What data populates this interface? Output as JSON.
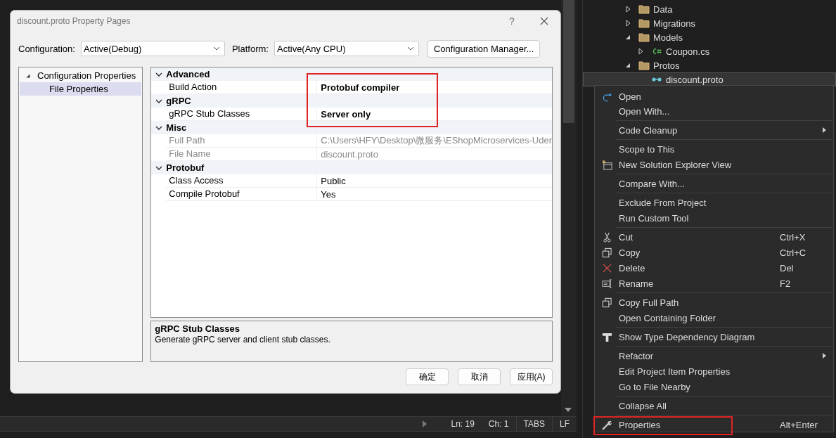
{
  "dialog": {
    "title": "discount.proto Property Pages",
    "help": "?",
    "configuration": {
      "label": "Configuration:",
      "value": "Active(Debug)"
    },
    "platform": {
      "label": "Platform:",
      "value": "Active(Any CPU)"
    },
    "manager_button": "Configuration Manager...",
    "tree": [
      {
        "label": "Configuration Properties",
        "expanded": true,
        "selected": false,
        "children": [
          {
            "label": "File Properties",
            "selected": true
          }
        ]
      }
    ],
    "grid": {
      "value_frame": true,
      "categories": [
        {
          "name": "Advanced",
          "expanded": true,
          "rows": [
            {
              "name": "Build Action",
              "value": "Protobuf compiler",
              "bold": true,
              "disabled": false
            }
          ]
        },
        {
          "name": "gRPC",
          "expanded": true,
          "rows": [
            {
              "name": "gRPC Stub Classes",
              "value": "Server only",
              "bold": true,
              "disabled": false
            }
          ]
        },
        {
          "name": "Misc",
          "expanded": true,
          "rows": [
            {
              "name": "Full Path",
              "value": "C:\\Users\\HFY\\Desktop\\微服务\\EShopMicroservices-Uder",
              "bold": false,
              "disabled": true
            },
            {
              "name": "File Name",
              "value": "discount.proto",
              "bold": false,
              "disabled": true
            }
          ]
        },
        {
          "name": "Protobuf",
          "expanded": true,
          "rows": [
            {
              "name": "Class Access",
              "value": "Public",
              "bold": false,
              "disabled": false
            },
            {
              "name": "Compile Protobuf",
              "value": "Yes",
              "bold": false,
              "disabled": false
            }
          ]
        }
      ]
    },
    "description": {
      "title": "gRPC Stub Classes",
      "text": "Generate gRPC server and client stub classes."
    },
    "buttons": [
      "确定",
      "取消",
      "应用(A)"
    ]
  },
  "status_bar": {
    "line": "Ln: 19",
    "column": "Ch: 1",
    "indent": "TABS",
    "line_ending": "LF"
  },
  "explorer": [
    {
      "label": "Data",
      "kind": "folder",
      "expanded": false,
      "selected": false
    },
    {
      "label": "Migrations",
      "kind": "folder",
      "expanded": false,
      "selected": false
    },
    {
      "label": "Models",
      "kind": "folder",
      "expanded": true,
      "selected": false,
      "children": [
        {
          "label": "Coupon.cs",
          "kind": "csharp",
          "expanded": false,
          "selected": false
        }
      ]
    },
    {
      "label": "Protos",
      "kind": "folder",
      "expanded": true,
      "selected": false,
      "children": [
        {
          "label": "discount.proto",
          "kind": "proto",
          "selected": true
        }
      ]
    }
  ],
  "context_menu": [
    [
      {
        "label": "Open",
        "kind": "open"
      },
      {
        "label": "Open With..."
      }
    ],
    [
      {
        "label": "Code Cleanup",
        "submenu": true
      }
    ],
    [
      {
        "label": "Scope to This"
      },
      {
        "label": "New Solution Explorer View",
        "kind": "window"
      }
    ],
    [
      {
        "label": "Compare With..."
      }
    ],
    [
      {
        "label": "Exclude From Project"
      },
      {
        "label": "Run Custom Tool"
      }
    ],
    [
      {
        "label": "Cut",
        "kind": "cut",
        "shortcut": "Ctrl+X"
      },
      {
        "label": "Copy",
        "kind": "copy",
        "shortcut": "Ctrl+C"
      },
      {
        "label": "Delete",
        "kind": "delete",
        "shortcut": "Del"
      },
      {
        "label": "Rename",
        "kind": "rename",
        "shortcut": "F2"
      }
    ],
    [
      {
        "label": "Copy Full Path",
        "kind": "copy"
      },
      {
        "label": "Open Containing Folder"
      }
    ],
    [
      {
        "label": "Show Type Dependency Diagram",
        "kind": "type"
      }
    ],
    [
      {
        "label": "Refactor",
        "submenu": true
      },
      {
        "label": "Edit Project Item Properties"
      },
      {
        "label": "Go to File Nearby"
      }
    ],
    [
      {
        "label": "Collapse All"
      }
    ],
    [
      {
        "label": "Properties",
        "kind": "wrench",
        "shortcut": "Alt+Enter",
        "highlighted": true
      }
    ]
  ]
}
